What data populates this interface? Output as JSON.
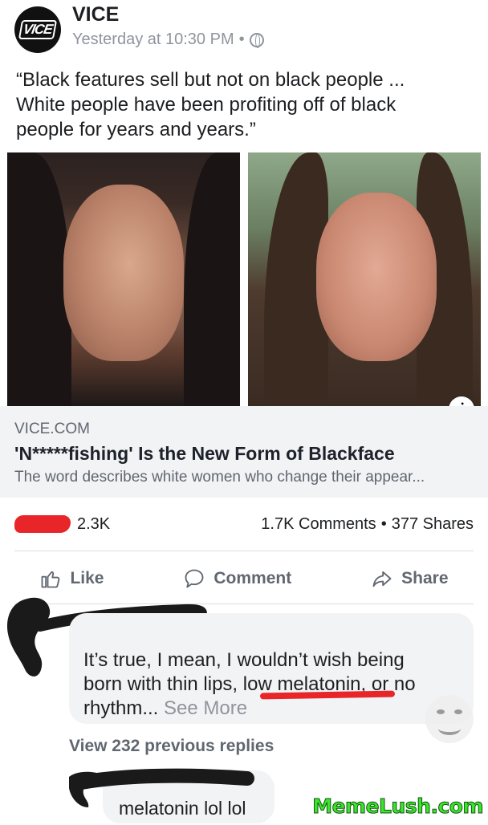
{
  "post": {
    "page_name": "VICE",
    "avatar_text": "VICE",
    "timestamp": "Yesterday at 10:30 PM",
    "separator": "•",
    "privacy_icon": "globe-icon",
    "text_line1": "“Black features sell but not on black people ...",
    "text_line2": "White people have been profiting off of black",
    "text_line3": "people for years and years.”"
  },
  "link": {
    "domain": "VICE.COM",
    "title": "'N*****fishing' Is the New Form of Blackface",
    "description": "The word describes white women who change their appear...",
    "info_icon": "i"
  },
  "stats": {
    "reaction_count": "2.3K",
    "comments": "1.7K Comments",
    "separator": "•",
    "shares": "377 Shares"
  },
  "actions": {
    "like": "Like",
    "comment": "Comment",
    "share": "Share"
  },
  "comment1": {
    "line1": "It’s true, I mean, I wouldn’t wish being",
    "line2": "born with thin lips, low melatonin, or no",
    "line3": "rhythm...",
    "see_more": "See More"
  },
  "view_replies": "View 232 previous replies",
  "comment2": {
    "text": "melatonin lol lol"
  },
  "watermark": "MemeLush.com",
  "colors": {
    "redaction_red": "#e8262a",
    "bubble_bg": "#f2f3f5",
    "muted_text": "#606770",
    "watermark_green": "#3be52c"
  }
}
